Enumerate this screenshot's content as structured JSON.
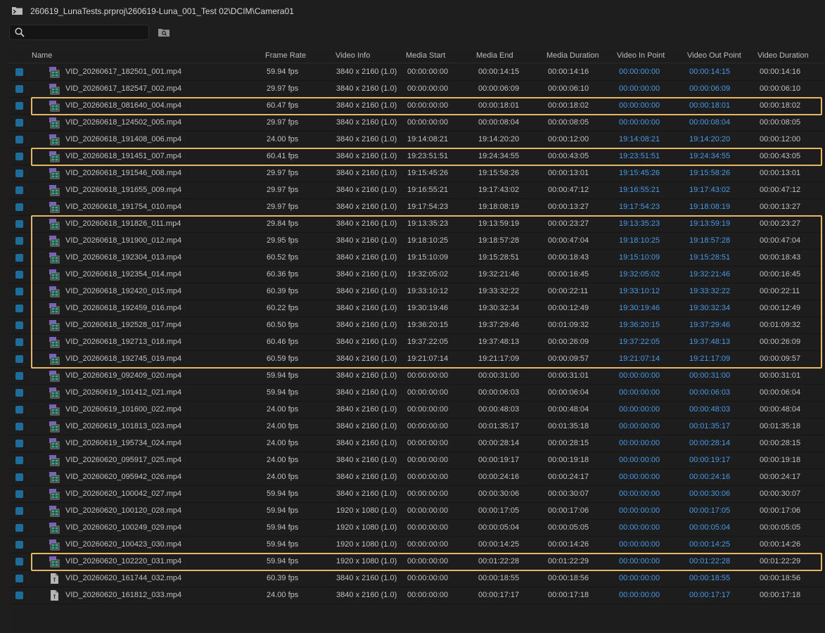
{
  "window": {
    "path": "260619_LunaTests.prproj\\260619-Luna_001_Test 02\\DCIM\\Camera01",
    "folder_icon": "bin-folder-icon"
  },
  "search": {
    "value": "",
    "placeholder": ""
  },
  "colors": {
    "accent_blue": "#4a9ae8",
    "checkbox": "#1d6d9c",
    "highlight": "#e8b766"
  },
  "columns": [
    "Name",
    "Frame Rate",
    "Video Info",
    "Media Start",
    "Media End",
    "Media Duration",
    "Video In Point",
    "Video Out Point",
    "Video Duration"
  ],
  "highlight_groups": [
    [
      2
    ],
    [
      5
    ],
    [
      9,
      17
    ],
    [
      29
    ]
  ],
  "rows": [
    {
      "icon": "video-clip-icon",
      "name": "VID_20260617_182501_001.mp4",
      "frame_rate": "59.94 fps",
      "video_info": "3840 x 2160 (1.0)",
      "media_start": "00:00:00:00",
      "media_end": "00:00:14:15",
      "media_duration": "00:00:14:16",
      "video_in": "00:00:00:00",
      "video_out": "00:00:14:15",
      "video_duration": "00:00:14:16"
    },
    {
      "icon": "video-clip-icon",
      "name": "VID_20260617_182547_002.mp4",
      "frame_rate": "29.97 fps",
      "video_info": "3840 x 2160 (1.0)",
      "media_start": "00:00:00:00",
      "media_end": "00:00:06:09",
      "media_duration": "00:00:06:10",
      "video_in": "00:00:00:00",
      "video_out": "00:00:06:09",
      "video_duration": "00:00:06:10"
    },
    {
      "icon": "video-clip-icon",
      "name": "VID_20260618_081640_004.mp4",
      "frame_rate": "60.47 fps",
      "video_info": "3840 x 2160 (1.0)",
      "media_start": "00:00:00:00",
      "media_end": "00:00:18:01",
      "media_duration": "00:00:18:02",
      "video_in": "00:00:00:00",
      "video_out": "00:00:18:01",
      "video_duration": "00:00:18:02"
    },
    {
      "icon": "video-clip-icon",
      "name": "VID_20260618_124502_005.mp4",
      "frame_rate": "29.97 fps",
      "video_info": "3840 x 2160 (1.0)",
      "media_start": "00:00:00:00",
      "media_end": "00:00:08:04",
      "media_duration": "00:00:08:05",
      "video_in": "00:00:00:00",
      "video_out": "00:00:08:04",
      "video_duration": "00:00:08:05"
    },
    {
      "icon": "video-clip-icon",
      "name": "VID_20260618_191408_006.mp4",
      "frame_rate": "24.00 fps",
      "video_info": "3840 x 2160 (1.0)",
      "media_start": "19:14:08:21",
      "media_end": "19:14:20:20",
      "media_duration": "00:00:12:00",
      "video_in": "19:14:08:21",
      "video_out": "19:14:20:20",
      "video_duration": "00:00:12:00"
    },
    {
      "icon": "video-clip-icon",
      "name": "VID_20260618_191451_007.mp4",
      "frame_rate": "60.41 fps",
      "video_info": "3840 x 2160 (1.0)",
      "media_start": "19:23:51:51",
      "media_end": "19:24:34:55",
      "media_duration": "00:00:43:05",
      "video_in": "19:23:51:51",
      "video_out": "19:24:34:55",
      "video_duration": "00:00:43:05"
    },
    {
      "icon": "video-clip-icon",
      "name": "VID_20260618_191546_008.mp4",
      "frame_rate": "29.97 fps",
      "video_info": "3840 x 2160 (1.0)",
      "media_start": "19:15:45:26",
      "media_end": "19:15:58:26",
      "media_duration": "00:00:13:01",
      "video_in": "19:15:45:26",
      "video_out": "19:15:58:26",
      "video_duration": "00:00:13:01"
    },
    {
      "icon": "video-clip-icon",
      "name": "VID_20260618_191655_009.mp4",
      "frame_rate": "29.97 fps",
      "video_info": "3840 x 2160 (1.0)",
      "media_start": "19:16:55:21",
      "media_end": "19:17:43:02",
      "media_duration": "00:00:47:12",
      "video_in": "19:16:55:21",
      "video_out": "19:17:43:02",
      "video_duration": "00:00:47:12"
    },
    {
      "icon": "video-clip-icon",
      "name": "VID_20260618_191754_010.mp4",
      "frame_rate": "29.97 fps",
      "video_info": "3840 x 2160 (1.0)",
      "media_start": "19:17:54:23",
      "media_end": "19:18:08:19",
      "media_duration": "00:00:13:27",
      "video_in": "19:17:54:23",
      "video_out": "19:18:08:19",
      "video_duration": "00:00:13:27"
    },
    {
      "icon": "video-clip-icon",
      "name": "VID_20260618_191826_011.mp4",
      "frame_rate": "29.84 fps",
      "video_info": "3840 x 2160 (1.0)",
      "media_start": "19:13:35:23",
      "media_end": "19:13:59:19",
      "media_duration": "00:00:23:27",
      "video_in": "19:13:35:23",
      "video_out": "19:13:59:19",
      "video_duration": "00:00:23:27"
    },
    {
      "icon": "video-clip-icon",
      "name": "VID_20260618_191900_012.mp4",
      "frame_rate": "29.95 fps",
      "video_info": "3840 x 2160 (1.0)",
      "media_start": "19:18:10:25",
      "media_end": "19:18:57:28",
      "media_duration": "00:00:47:04",
      "video_in": "19:18:10:25",
      "video_out": "19:18:57:28",
      "video_duration": "00:00:47:04"
    },
    {
      "icon": "video-clip-icon",
      "name": "VID_20260618_192304_013.mp4",
      "frame_rate": "60.52 fps",
      "video_info": "3840 x 2160 (1.0)",
      "media_start": "19:15:10:09",
      "media_end": "19:15:28:51",
      "media_duration": "00:00:18:43",
      "video_in": "19:15:10:09",
      "video_out": "19:15:28:51",
      "video_duration": "00:00:18:43"
    },
    {
      "icon": "video-clip-icon",
      "name": "VID_20260618_192354_014.mp4",
      "frame_rate": "60.36 fps",
      "video_info": "3840 x 2160 (1.0)",
      "media_start": "19:32:05:02",
      "media_end": "19:32:21:46",
      "media_duration": "00:00:16:45",
      "video_in": "19:32:05:02",
      "video_out": "19:32:21:46",
      "video_duration": "00:00:16:45"
    },
    {
      "icon": "video-clip-icon",
      "name": "VID_20260618_192420_015.mp4",
      "frame_rate": "60.39 fps",
      "video_info": "3840 x 2160 (1.0)",
      "media_start": "19:33:10:12",
      "media_end": "19:33:32:22",
      "media_duration": "00:00:22:11",
      "video_in": "19:33:10:12",
      "video_out": "19:33:32:22",
      "video_duration": "00:00:22:11"
    },
    {
      "icon": "video-clip-icon",
      "name": "VID_20260618_192459_016.mp4",
      "frame_rate": "60.22 fps",
      "video_info": "3840 x 2160 (1.0)",
      "media_start": "19:30:19:46",
      "media_end": "19:30:32:34",
      "media_duration": "00:00:12:49",
      "video_in": "19:30:19:46",
      "video_out": "19:30:32:34",
      "video_duration": "00:00:12:49"
    },
    {
      "icon": "video-clip-icon",
      "name": "VID_20260618_192528_017.mp4",
      "frame_rate": "60.50 fps",
      "video_info": "3840 x 2160 (1.0)",
      "media_start": "19:36:20:15",
      "media_end": "19:37:29:46",
      "media_duration": "00:01:09:32",
      "video_in": "19:36:20:15",
      "video_out": "19:37:29:46",
      "video_duration": "00:01:09:32"
    },
    {
      "icon": "video-clip-icon",
      "name": "VID_20260618_192713_018.mp4",
      "frame_rate": "60.46 fps",
      "video_info": "3840 x 2160 (1.0)",
      "media_start": "19:37:22:05",
      "media_end": "19:37:48:13",
      "media_duration": "00:00:26:09",
      "video_in": "19:37:22:05",
      "video_out": "19:37:48:13",
      "video_duration": "00:00:26:09"
    },
    {
      "icon": "video-clip-icon",
      "name": "VID_20260618_192745_019.mp4",
      "frame_rate": "60.59 fps",
      "video_info": "3840 x 2160 (1.0)",
      "media_start": "19:21:07:14",
      "media_end": "19:21:17:09",
      "media_duration": "00:00:09:57",
      "video_in": "19:21:07:14",
      "video_out": "19:21:17:09",
      "video_duration": "00:00:09:57"
    },
    {
      "icon": "video-clip-icon",
      "name": "VID_20260619_092409_020.mp4",
      "frame_rate": "59.94 fps",
      "video_info": "3840 x 2160 (1.0)",
      "media_start": "00:00:00:00",
      "media_end": "00:00:31:00",
      "media_duration": "00:00:31:01",
      "video_in": "00:00:00:00",
      "video_out": "00:00:31:00",
      "video_duration": "00:00:31:01"
    },
    {
      "icon": "video-clip-icon",
      "name": "VID_20260619_101412_021.mp4",
      "frame_rate": "59.94 fps",
      "video_info": "3840 x 2160 (1.0)",
      "media_start": "00:00:00:00",
      "media_end": "00:00:06:03",
      "media_duration": "00:00:06:04",
      "video_in": "00:00:00:00",
      "video_out": "00:00:06:03",
      "video_duration": "00:00:06:04"
    },
    {
      "icon": "video-clip-icon",
      "name": "VID_20260619_101600_022.mp4",
      "frame_rate": "24.00 fps",
      "video_info": "3840 x 2160 (1.0)",
      "media_start": "00:00:00:00",
      "media_end": "00:00:48:03",
      "media_duration": "00:00:48:04",
      "video_in": "00:00:00:00",
      "video_out": "00:00:48:03",
      "video_duration": "00:00:48:04"
    },
    {
      "icon": "video-clip-icon",
      "name": "VID_20260619_101813_023.mp4",
      "frame_rate": "24.00 fps",
      "video_info": "3840 x 2160 (1.0)",
      "media_start": "00:00:00:00",
      "media_end": "00:01:35:17",
      "media_duration": "00:01:35:18",
      "video_in": "00:00:00:00",
      "video_out": "00:01:35:17",
      "video_duration": "00:01:35:18"
    },
    {
      "icon": "video-clip-icon",
      "name": "VID_20260619_195734_024.mp4",
      "frame_rate": "24.00 fps",
      "video_info": "3840 x 2160 (1.0)",
      "media_start": "00:00:00:00",
      "media_end": "00:00:28:14",
      "media_duration": "00:00:28:15",
      "video_in": "00:00:00:00",
      "video_out": "00:00:28:14",
      "video_duration": "00:00:28:15"
    },
    {
      "icon": "video-clip-icon",
      "name": "VID_20260620_095917_025.mp4",
      "frame_rate": "24.00 fps",
      "video_info": "3840 x 2160 (1.0)",
      "media_start": "00:00:00:00",
      "media_end": "00:00:19:17",
      "media_duration": "00:00:19:18",
      "video_in": "00:00:00:00",
      "video_out": "00:00:19:17",
      "video_duration": "00:00:19:18"
    },
    {
      "icon": "video-clip-icon",
      "name": "VID_20260620_095942_026.mp4",
      "frame_rate": "24.00 fps",
      "video_info": "3840 x 2160 (1.0)",
      "media_start": "00:00:00:00",
      "media_end": "00:00:24:16",
      "media_duration": "00:00:24:17",
      "video_in": "00:00:00:00",
      "video_out": "00:00:24:16",
      "video_duration": "00:00:24:17"
    },
    {
      "icon": "video-clip-icon",
      "name": "VID_20260620_100042_027.mp4",
      "frame_rate": "59.94 fps",
      "video_info": "3840 x 2160 (1.0)",
      "media_start": "00:00:00:00",
      "media_end": "00:00:30:06",
      "media_duration": "00:00:30:07",
      "video_in": "00:00:00:00",
      "video_out": "00:00:30:06",
      "video_duration": "00:00:30:07"
    },
    {
      "icon": "video-clip-icon",
      "name": "VID_20260620_100120_028.mp4",
      "frame_rate": "59.94 fps",
      "video_info": "1920 x 1080 (1.0)",
      "media_start": "00:00:00:00",
      "media_end": "00:00:17:05",
      "media_duration": "00:00:17:06",
      "video_in": "00:00:00:00",
      "video_out": "00:00:17:05",
      "video_duration": "00:00:17:06"
    },
    {
      "icon": "video-clip-icon",
      "name": "VID_20260620_100249_029.mp4",
      "frame_rate": "59.94 fps",
      "video_info": "1920 x 1080 (1.0)",
      "media_start": "00:00:00:00",
      "media_end": "00:00:05:04",
      "media_duration": "00:00:05:05",
      "video_in": "00:00:00:00",
      "video_out": "00:00:05:04",
      "video_duration": "00:00:05:05"
    },
    {
      "icon": "video-clip-icon",
      "name": "VID_20260620_100423_030.mp4",
      "frame_rate": "59.94 fps",
      "video_info": "1920 x 1080 (1.0)",
      "media_start": "00:00:00:00",
      "media_end": "00:00:14:25",
      "media_duration": "00:00:14:26",
      "video_in": "00:00:00:00",
      "video_out": "00:00:14:25",
      "video_duration": "00:00:14:26"
    },
    {
      "icon": "video-clip-icon",
      "name": "VID_20260620_102220_031.mp4",
      "frame_rate": "59.94 fps",
      "video_info": "1920 x 1080 (1.0)",
      "media_start": "00:00:00:00",
      "media_end": "00:01:22:28",
      "media_duration": "00:01:22:29",
      "video_in": "00:00:00:00",
      "video_out": "00:01:22:28",
      "video_duration": "00:01:22:29"
    },
    {
      "icon": "generic-file-icon",
      "name": "VID_20260620_161744_032.mp4",
      "frame_rate": "60.39 fps",
      "video_info": "3840 x 2160 (1.0)",
      "media_start": "00:00:00:00",
      "media_end": "00:00:18:55",
      "media_duration": "00:00:18:56",
      "video_in": "00:00:00:00",
      "video_out": "00:00:18:55",
      "video_duration": "00:00:18:56"
    },
    {
      "icon": "generic-file-icon",
      "name": "VID_20260620_161812_033.mp4",
      "frame_rate": "24.00 fps",
      "video_info": "3840 x 2160 (1.0)",
      "media_start": "00:00:00:00",
      "media_end": "00:00:17:17",
      "media_duration": "00:00:17:18",
      "video_in": "00:00:00:00",
      "video_out": "00:00:17:17",
      "video_duration": "00:00:17:18"
    }
  ]
}
